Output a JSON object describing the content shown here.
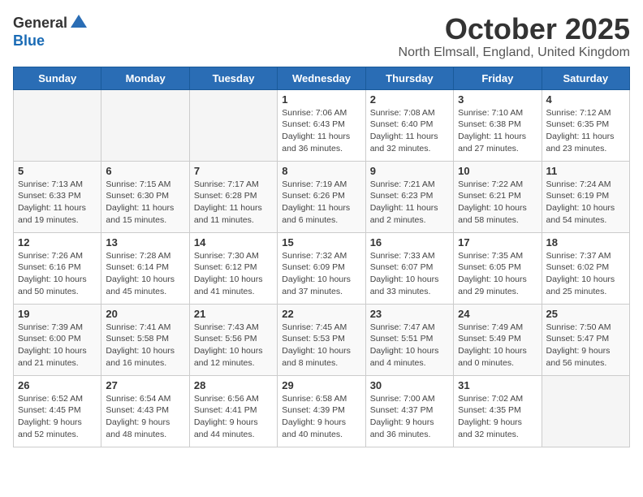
{
  "logo": {
    "general": "General",
    "blue": "Blue"
  },
  "title": "October 2025",
  "location": "North Elmsall, England, United Kingdom",
  "days_header": [
    "Sunday",
    "Monday",
    "Tuesday",
    "Wednesday",
    "Thursday",
    "Friday",
    "Saturday"
  ],
  "weeks": [
    [
      {
        "day": "",
        "info": ""
      },
      {
        "day": "",
        "info": ""
      },
      {
        "day": "",
        "info": ""
      },
      {
        "day": "1",
        "info": "Sunrise: 7:06 AM\nSunset: 6:43 PM\nDaylight: 11 hours\nand 36 minutes."
      },
      {
        "day": "2",
        "info": "Sunrise: 7:08 AM\nSunset: 6:40 PM\nDaylight: 11 hours\nand 32 minutes."
      },
      {
        "day": "3",
        "info": "Sunrise: 7:10 AM\nSunset: 6:38 PM\nDaylight: 11 hours\nand 27 minutes."
      },
      {
        "day": "4",
        "info": "Sunrise: 7:12 AM\nSunset: 6:35 PM\nDaylight: 11 hours\nand 23 minutes."
      }
    ],
    [
      {
        "day": "5",
        "info": "Sunrise: 7:13 AM\nSunset: 6:33 PM\nDaylight: 11 hours\nand 19 minutes."
      },
      {
        "day": "6",
        "info": "Sunrise: 7:15 AM\nSunset: 6:30 PM\nDaylight: 11 hours\nand 15 minutes."
      },
      {
        "day": "7",
        "info": "Sunrise: 7:17 AM\nSunset: 6:28 PM\nDaylight: 11 hours\nand 11 minutes."
      },
      {
        "day": "8",
        "info": "Sunrise: 7:19 AM\nSunset: 6:26 PM\nDaylight: 11 hours\nand 6 minutes."
      },
      {
        "day": "9",
        "info": "Sunrise: 7:21 AM\nSunset: 6:23 PM\nDaylight: 11 hours\nand 2 minutes."
      },
      {
        "day": "10",
        "info": "Sunrise: 7:22 AM\nSunset: 6:21 PM\nDaylight: 10 hours\nand 58 minutes."
      },
      {
        "day": "11",
        "info": "Sunrise: 7:24 AM\nSunset: 6:19 PM\nDaylight: 10 hours\nand 54 minutes."
      }
    ],
    [
      {
        "day": "12",
        "info": "Sunrise: 7:26 AM\nSunset: 6:16 PM\nDaylight: 10 hours\nand 50 minutes."
      },
      {
        "day": "13",
        "info": "Sunrise: 7:28 AM\nSunset: 6:14 PM\nDaylight: 10 hours\nand 45 minutes."
      },
      {
        "day": "14",
        "info": "Sunrise: 7:30 AM\nSunset: 6:12 PM\nDaylight: 10 hours\nand 41 minutes."
      },
      {
        "day": "15",
        "info": "Sunrise: 7:32 AM\nSunset: 6:09 PM\nDaylight: 10 hours\nand 37 minutes."
      },
      {
        "day": "16",
        "info": "Sunrise: 7:33 AM\nSunset: 6:07 PM\nDaylight: 10 hours\nand 33 minutes."
      },
      {
        "day": "17",
        "info": "Sunrise: 7:35 AM\nSunset: 6:05 PM\nDaylight: 10 hours\nand 29 minutes."
      },
      {
        "day": "18",
        "info": "Sunrise: 7:37 AM\nSunset: 6:02 PM\nDaylight: 10 hours\nand 25 minutes."
      }
    ],
    [
      {
        "day": "19",
        "info": "Sunrise: 7:39 AM\nSunset: 6:00 PM\nDaylight: 10 hours\nand 21 minutes."
      },
      {
        "day": "20",
        "info": "Sunrise: 7:41 AM\nSunset: 5:58 PM\nDaylight: 10 hours\nand 16 minutes."
      },
      {
        "day": "21",
        "info": "Sunrise: 7:43 AM\nSunset: 5:56 PM\nDaylight: 10 hours\nand 12 minutes."
      },
      {
        "day": "22",
        "info": "Sunrise: 7:45 AM\nSunset: 5:53 PM\nDaylight: 10 hours\nand 8 minutes."
      },
      {
        "day": "23",
        "info": "Sunrise: 7:47 AM\nSunset: 5:51 PM\nDaylight: 10 hours\nand 4 minutes."
      },
      {
        "day": "24",
        "info": "Sunrise: 7:49 AM\nSunset: 5:49 PM\nDaylight: 10 hours\nand 0 minutes."
      },
      {
        "day": "25",
        "info": "Sunrise: 7:50 AM\nSunset: 5:47 PM\nDaylight: 9 hours\nand 56 minutes."
      }
    ],
    [
      {
        "day": "26",
        "info": "Sunrise: 6:52 AM\nSunset: 4:45 PM\nDaylight: 9 hours\nand 52 minutes."
      },
      {
        "day": "27",
        "info": "Sunrise: 6:54 AM\nSunset: 4:43 PM\nDaylight: 9 hours\nand 48 minutes."
      },
      {
        "day": "28",
        "info": "Sunrise: 6:56 AM\nSunset: 4:41 PM\nDaylight: 9 hours\nand 44 minutes."
      },
      {
        "day": "29",
        "info": "Sunrise: 6:58 AM\nSunset: 4:39 PM\nDaylight: 9 hours\nand 40 minutes."
      },
      {
        "day": "30",
        "info": "Sunrise: 7:00 AM\nSunset: 4:37 PM\nDaylight: 9 hours\nand 36 minutes."
      },
      {
        "day": "31",
        "info": "Sunrise: 7:02 AM\nSunset: 4:35 PM\nDaylight: 9 hours\nand 32 minutes."
      },
      {
        "day": "",
        "info": ""
      }
    ]
  ]
}
